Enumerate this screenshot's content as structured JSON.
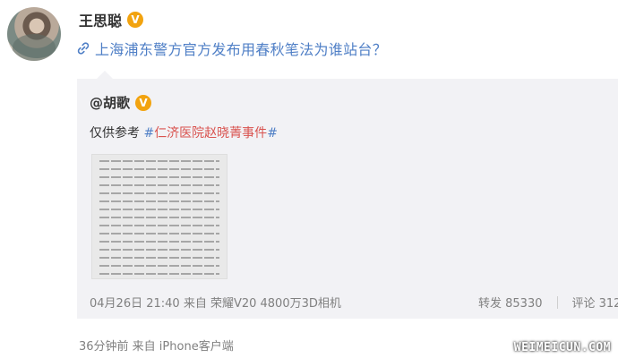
{
  "post": {
    "author": "王思聪",
    "verified_badge": "V",
    "link_text": "上海浦东警方官方发布用春秋笔法为谁站台？",
    "time_source": "36分钟前  来自 iPhone客户端"
  },
  "repost": {
    "author": "@胡歌",
    "verified_badge": "V",
    "text_prefix": "仅供参考 ",
    "topic_hash_open": "#",
    "topic": "仁济医院赵晓菁事件",
    "topic_hash_close": "#",
    "meta": "04月26日 21:40  来自 荣耀V20 4800万3D相机",
    "forward": "转发 85330",
    "comment": "评论 312"
  },
  "watermark": "WEIMEICUN.COM",
  "icons": {
    "link": "link-icon",
    "avatar": "avatar-image",
    "thumbnail": "document-thumbnail"
  },
  "colors": {
    "link": "#4f7fc6",
    "topic": "#d9534f",
    "badge": "#f2a30f",
    "repost_bg": "#f2f2f5"
  }
}
